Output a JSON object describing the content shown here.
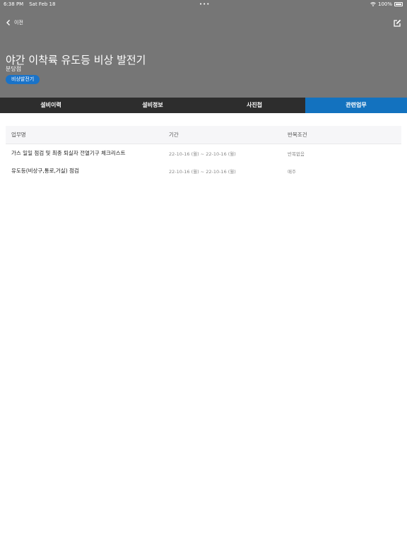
{
  "status": {
    "time": "6:38 PM",
    "date": "Sat Feb 18",
    "battery": "100%"
  },
  "nav": {
    "back_label": "이전"
  },
  "equipment": {
    "title": "야간 이착륙 유도등 비상 발전기",
    "location": "분당점",
    "category_tag": "비상발전기"
  },
  "tabs": [
    {
      "label": "설비이력"
    },
    {
      "label": "설비정보"
    },
    {
      "label": "사진첩"
    },
    {
      "label": "관련업무"
    }
  ],
  "table": {
    "headers": [
      "업무명",
      "기간",
      "반복조건"
    ],
    "rows": [
      {
        "name": "가스 일일 점검 및 최종 퇴실자 전열기구 체크리스트",
        "period": "22-10-16 (월) ~ 22-10-16 (월)",
        "repeat": "반복없음"
      },
      {
        "name": "유도등(비상구,통로,거실) 점검",
        "period": "22-10-16 (월) ~ 22-10-16 (월)",
        "repeat": "매주"
      }
    ]
  },
  "colors": {
    "header_bg": "#767676",
    "tab_bar_bg": "#2d2d2d",
    "accent": "#1372bf"
  }
}
